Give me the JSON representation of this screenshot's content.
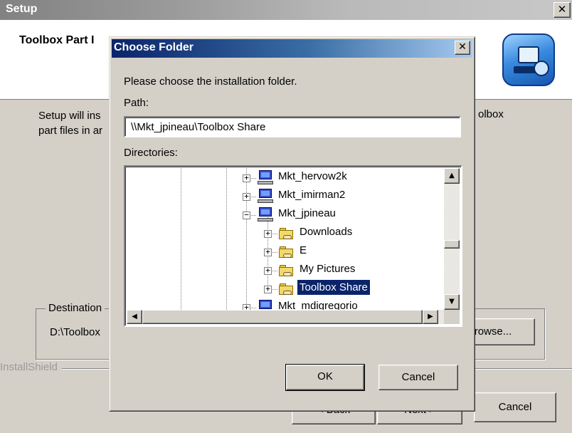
{
  "setup": {
    "title": "Setup",
    "close_glyph": "✕",
    "header": {
      "heading": "Toolbox Part I",
      "logo_icon": "installshield-computer-icon"
    },
    "description_left": "Setup will ins\npart files in ar",
    "description_right": "olbox",
    "destination": {
      "legend": "Destination",
      "path": "D:\\Toolbox"
    },
    "browse_label": "rowse...",
    "brand_label": "InstallShield",
    "back_label": "< Back",
    "next_label": "Next >",
    "cancel_label": "Cancel"
  },
  "dialog": {
    "title": "Choose Folder",
    "close_glyph": "✕",
    "prompt": "Please choose the installation folder.",
    "path_label": "Path:",
    "path_value": "\\\\Mkt_jpineau\\Toolbox Share",
    "directories_label": "Directories:",
    "tree": [
      {
        "label": "Mkt_hervow2k",
        "icon": "computer-icon",
        "expander": "+",
        "level": 0,
        "selected": false
      },
      {
        "label": "Mkt_imirman2",
        "icon": "computer-icon",
        "expander": "+",
        "level": 0,
        "selected": false
      },
      {
        "label": "Mkt_jpineau",
        "icon": "computer-icon",
        "expander": "−",
        "level": 0,
        "selected": false
      },
      {
        "label": "Downloads",
        "icon": "shared-folder-icon",
        "expander": "+",
        "level": 1,
        "selected": false
      },
      {
        "label": "E",
        "icon": "shared-folder-icon",
        "expander": "+",
        "level": 1,
        "selected": false
      },
      {
        "label": "My Pictures",
        "icon": "shared-folder-icon",
        "expander": "+",
        "level": 1,
        "selected": false
      },
      {
        "label": "Toolbox Share",
        "icon": "shared-folder-icon",
        "expander": "+",
        "level": 1,
        "selected": true
      },
      {
        "label": "Mkt_mdigregorio",
        "icon": "computer-icon",
        "expander": "+",
        "level": 0,
        "selected": false
      }
    ],
    "scroll_up_glyph": "▲",
    "scroll_down_glyph": "▼",
    "scroll_left_glyph": "◀",
    "scroll_right_glyph": "▶",
    "ok_label": "OK",
    "cancel_label": "Cancel"
  }
}
